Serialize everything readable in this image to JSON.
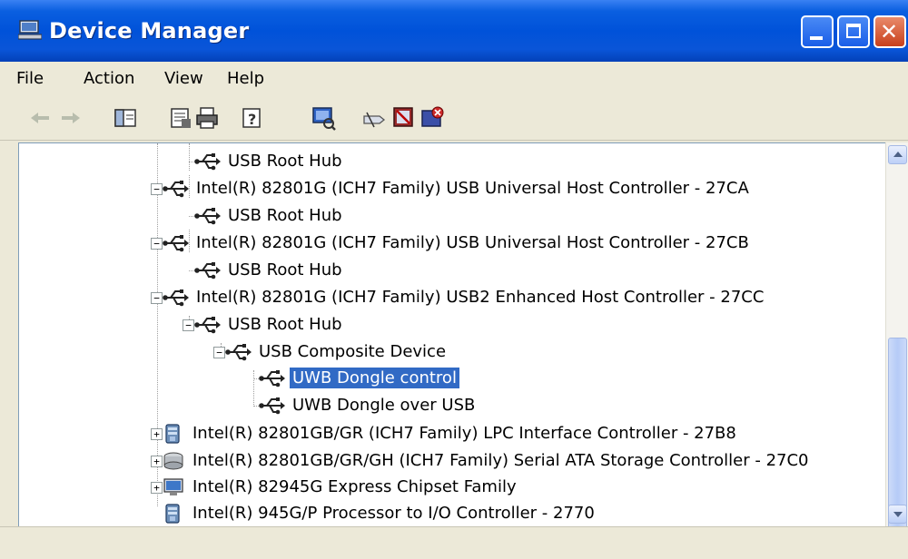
{
  "window": {
    "title": "Device Manager"
  },
  "menu": [
    "File",
    "Action",
    "View",
    "Help"
  ],
  "toolbar": [
    {
      "name": "back-icon"
    },
    {
      "name": "forward-icon"
    },
    {
      "name": "show-hide-console-tree-icon"
    },
    {
      "name": "properties-icon"
    },
    {
      "name": "print-icon"
    },
    {
      "name": "help-icon"
    },
    {
      "name": "scan-hardware-icon"
    },
    {
      "name": "update-driver-icon"
    },
    {
      "name": "disable-device-icon"
    },
    {
      "name": "uninstall-device-icon"
    }
  ],
  "tree": {
    "rows": [
      {
        "label": "USB Root Hub",
        "icon": "usb-icon",
        "expander": null,
        "selected": false
      },
      {
        "label": "Intel(R) 82801G (ICH7 Family) USB Universal Host Controller - 27CA",
        "icon": "usb-icon",
        "expander": "−",
        "selected": false
      },
      {
        "label": "USB Root Hub",
        "icon": "usb-icon",
        "expander": null,
        "selected": false
      },
      {
        "label": "Intel(R) 82801G (ICH7 Family) USB Universal Host Controller - 27CB",
        "icon": "usb-icon",
        "expander": "−",
        "selected": false
      },
      {
        "label": "USB Root Hub",
        "icon": "usb-icon",
        "expander": null,
        "selected": false
      },
      {
        "label": "Intel(R) 82801G (ICH7 Family) USB2 Enhanced Host Controller - 27CC",
        "icon": "usb-icon",
        "expander": "−",
        "selected": false
      },
      {
        "label": "USB Root Hub",
        "icon": "usb-icon",
        "expander": "−",
        "selected": false
      },
      {
        "label": "USB Composite Device",
        "icon": "usb-icon",
        "expander": "−",
        "selected": false
      },
      {
        "label": "UWB Dongle control",
        "icon": "usb-icon",
        "expander": null,
        "selected": true
      },
      {
        "label": "UWB Dongle over USB",
        "icon": "usb-icon",
        "expander": null,
        "selected": false
      },
      {
        "label": "Intel(R) 82801GB/GR (ICH7 Family) LPC Interface Controller - 27B8",
        "icon": "system-device-icon",
        "expander": "+",
        "selected": false
      },
      {
        "label": "Intel(R) 82801GB/GR/GH (ICH7 Family) Serial ATA Storage Controller - 27C0",
        "icon": "storage-controller-icon",
        "expander": "+",
        "selected": false
      },
      {
        "label": "Intel(R) 82945G Express Chipset Family",
        "icon": "display-adapter-icon",
        "expander": "+",
        "selected": false
      },
      {
        "label": "Intel(R) 945G/P Processor to I/O Controller - 2770",
        "icon": "system-device-icon",
        "expander": null,
        "selected": false
      }
    ]
  },
  "colors": {
    "titlebar": "#0052d9",
    "selection": "#316ac5",
    "chrome": "#ece9d8"
  }
}
